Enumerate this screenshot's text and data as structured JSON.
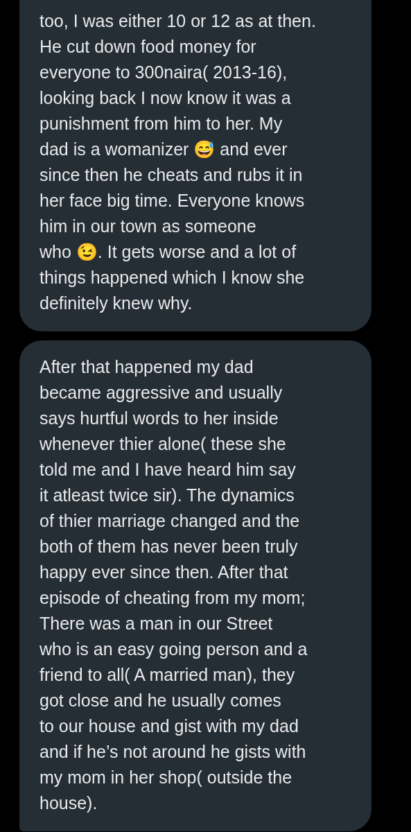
{
  "messages": [
    {
      "text": "too, I was either 10 or 12 as at then.\nHe cut down food money for\neveryone to 300naira( 2013-16),\nlooking back I now know it was a\npunishment from him to her. My\ndad is a womanizer 😅 and ever\nsince then he cheats and rubs it in\nher face big time. Everyone knows\nhim in our town as someone\nwho 😉. It gets worse and a lot of\nthings happened which I know she\ndefinitely knew why."
    },
    {
      "text": "After that happened my dad\nbecame aggressive and usually\nsays hurtful words to her inside\nwhenever thier alone( these she\ntold me and I have heard him say\nit atleast twice sir). The dynamics\nof thier marriage changed and the\nboth of them has never been truly\nhappy ever since then. After that\nepisode of cheating from my mom;\nThere was a man in our Street\nwho is an easy going person and a\nfriend to all( A married man), they\ngot close and he usually comes\nto our house and gist with my dad\nand if he’s not around he gists with\nmy mom in her shop( outside the\nhouse)."
    }
  ]
}
